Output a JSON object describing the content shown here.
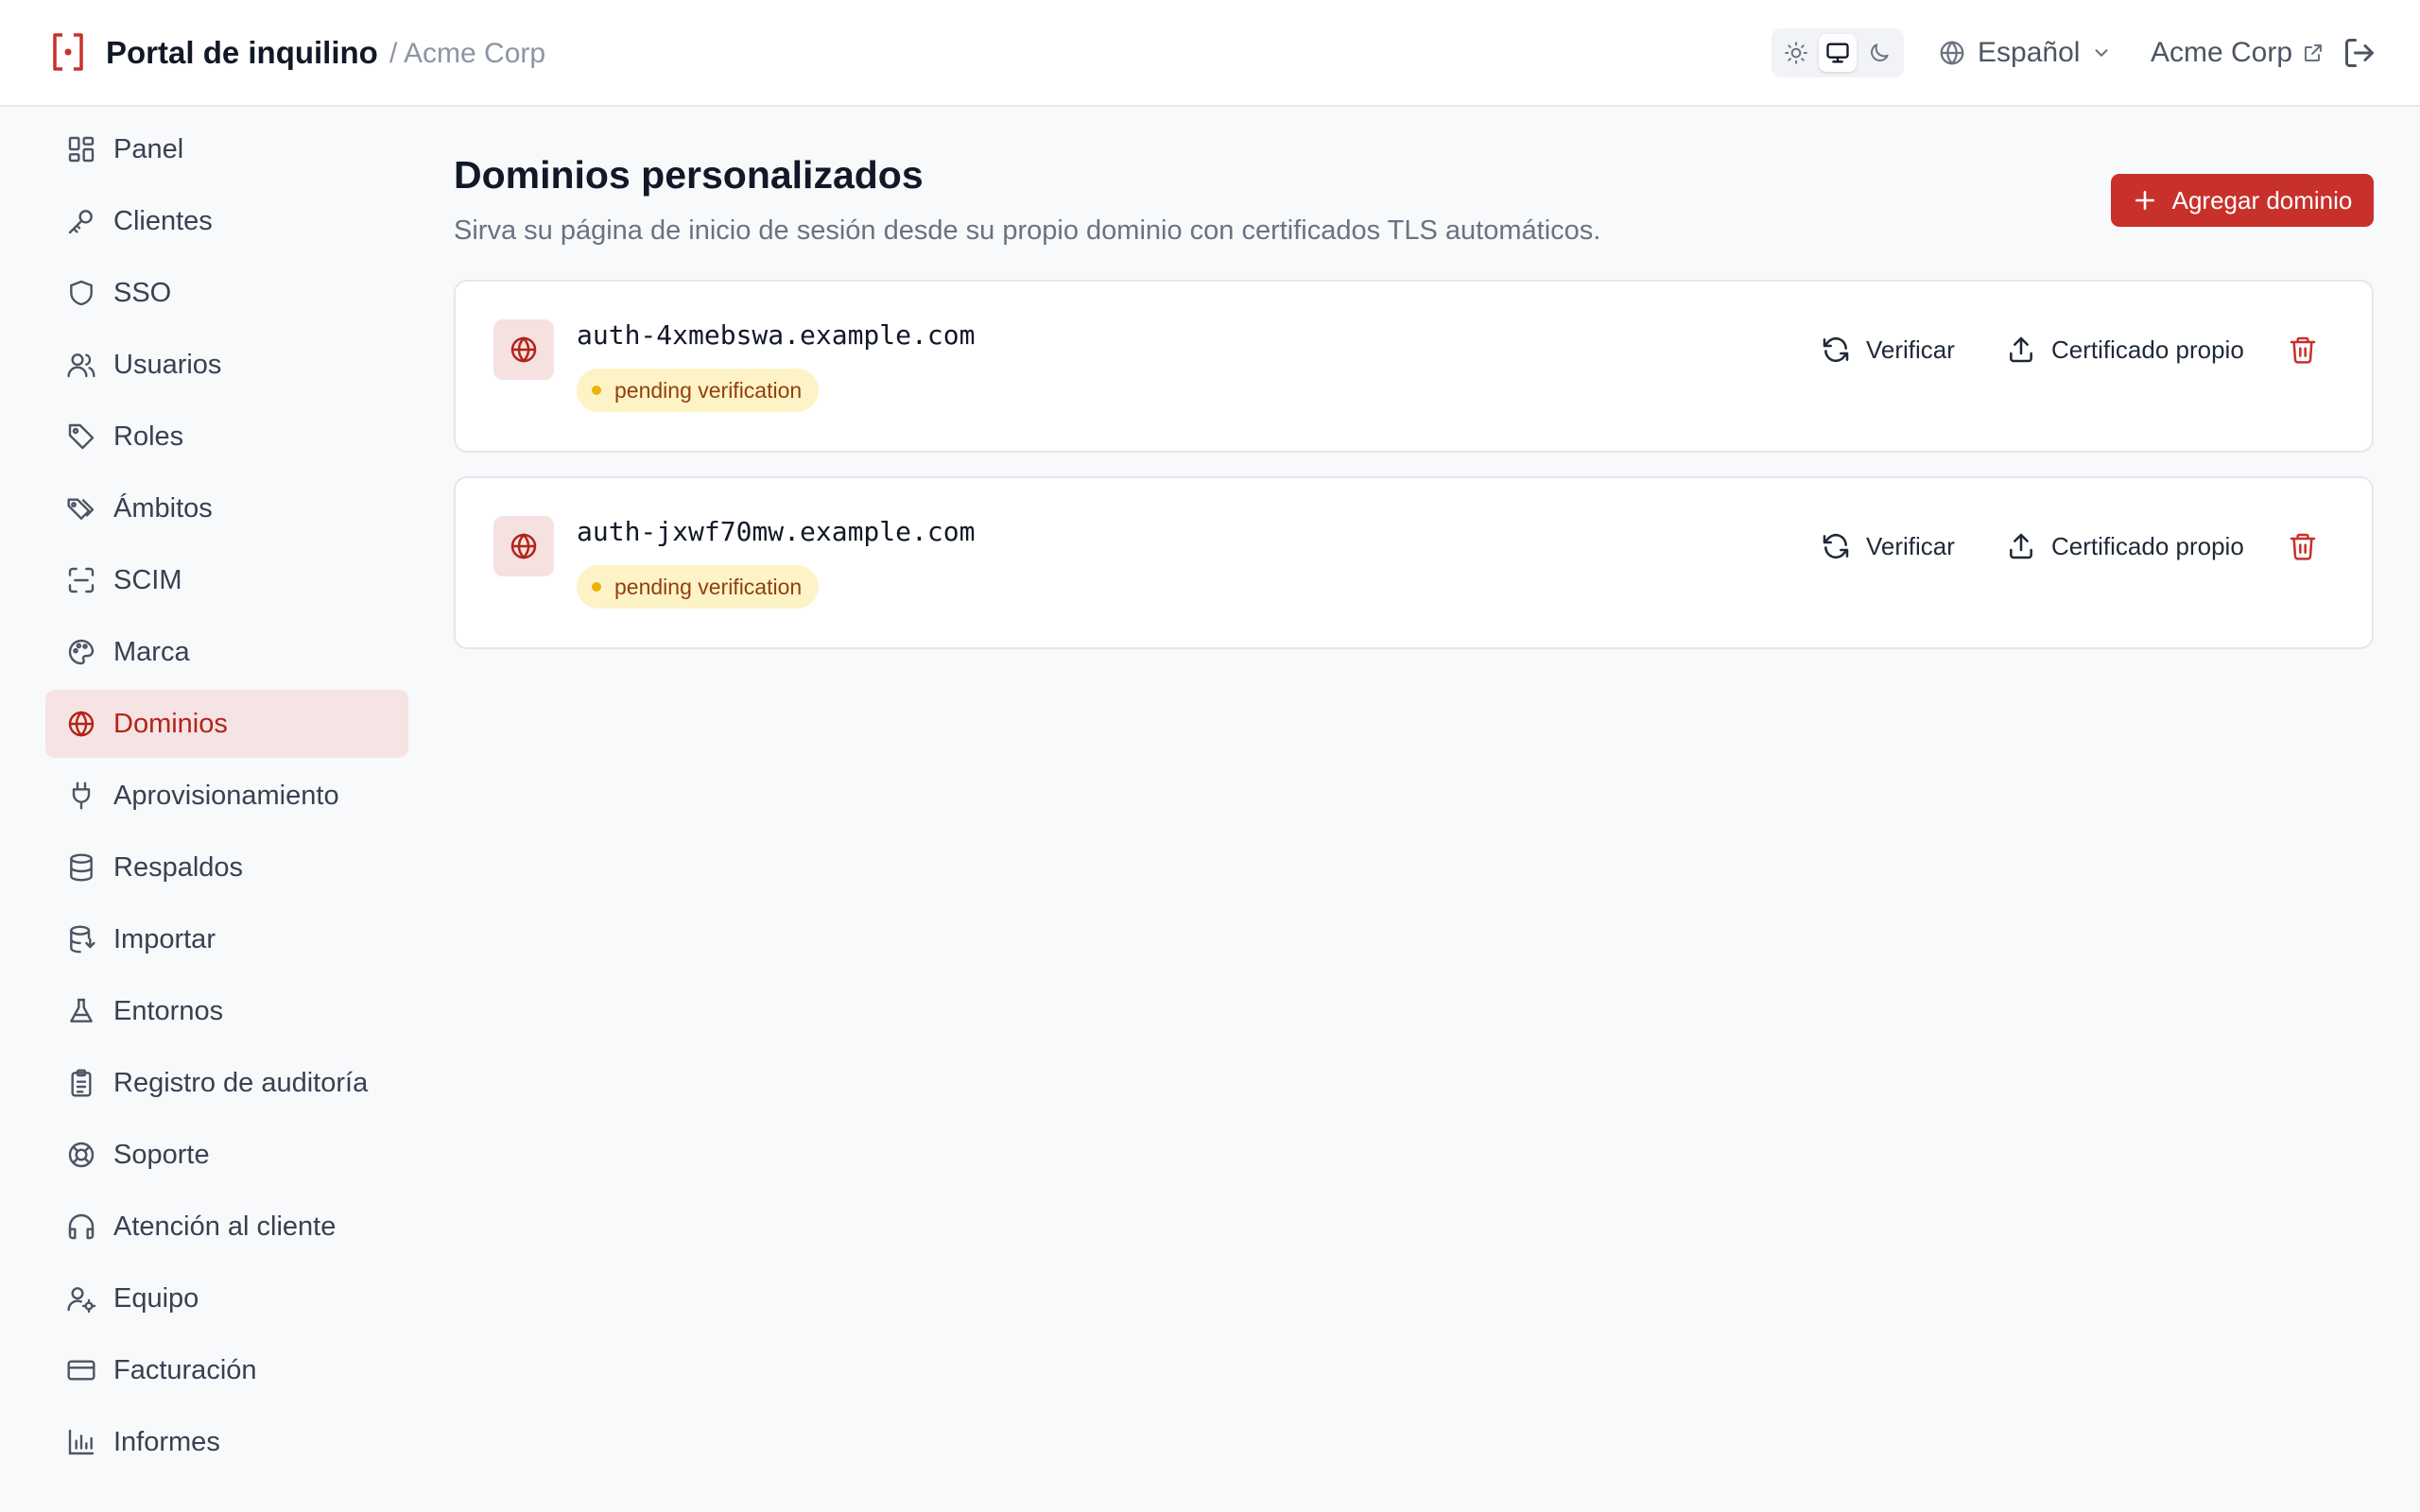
{
  "header": {
    "app_title": "Portal de inquilino",
    "crumb": "/ Acme Corp",
    "language": "Español",
    "org_name": "Acme Corp",
    "theme_options": [
      "light",
      "system",
      "dark"
    ],
    "theme_active": "system"
  },
  "sidebar": {
    "active": "Dominios",
    "items": [
      {
        "label": "Panel",
        "icon": "dashboard-icon"
      },
      {
        "label": "Clientes",
        "icon": "key-icon"
      },
      {
        "label": "SSO",
        "icon": "shield-icon"
      },
      {
        "label": "Usuarios",
        "icon": "users-icon"
      },
      {
        "label": "Roles",
        "icon": "tag-icon"
      },
      {
        "label": "Ámbitos",
        "icon": "tags-icon"
      },
      {
        "label": "SCIM",
        "icon": "scan-icon"
      },
      {
        "label": "Marca",
        "icon": "palette-icon"
      },
      {
        "label": "Dominios",
        "icon": "globe-icon"
      },
      {
        "label": "Aprovisionamiento",
        "icon": "plug-icon"
      },
      {
        "label": "Respaldos",
        "icon": "database-icon"
      },
      {
        "label": "Importar",
        "icon": "database-import-icon"
      },
      {
        "label": "Entornos",
        "icon": "flask-icon"
      },
      {
        "label": "Registro de auditoría",
        "icon": "clipboard-icon"
      },
      {
        "label": "Soporte",
        "icon": "lifebuoy-icon"
      },
      {
        "label": "Atención al cliente",
        "icon": "headphones-icon"
      },
      {
        "label": "Equipo",
        "icon": "user-cog-icon"
      },
      {
        "label": "Facturación",
        "icon": "credit-card-icon"
      },
      {
        "label": "Informes",
        "icon": "bar-chart-icon"
      }
    ]
  },
  "main": {
    "title": "Dominios personalizados",
    "subtitle": "Sirva su página de inicio de sesión desde su propio dominio con certificados TLS automáticos.",
    "add_button": "Agregar dominio",
    "domains": [
      {
        "name": "auth-4xmebswa.example.com",
        "status": "pending verification"
      },
      {
        "name": "auth-jxwf70mw.example.com",
        "status": "pending verification"
      }
    ],
    "verify_label": "Verificar",
    "cert_label": "Certificado propio"
  },
  "colors": {
    "accent": "#c8312b",
    "active_bg": "#f6e3e4",
    "badge_bg": "#fdf3c6",
    "badge_dot": "#eab308"
  }
}
